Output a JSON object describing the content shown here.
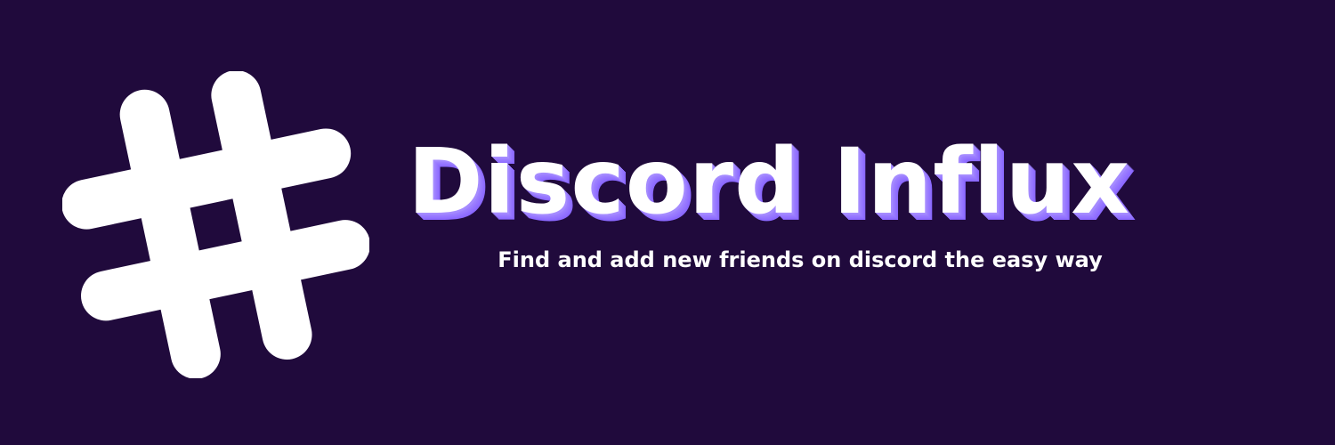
{
  "banner": {
    "title": "Discord Influx",
    "subtitle": "Find and add new friends on discord the easy way",
    "logo_icon": "hashtag-icon"
  },
  "colors": {
    "background": "#200a3c",
    "text": "#ffffff",
    "title_shadow": "#8a68ff",
    "logo_gradient_start": "#ff22e0",
    "logo_gradient_mid": "#9b22ff",
    "logo_gradient_end": "#2a22ff"
  }
}
